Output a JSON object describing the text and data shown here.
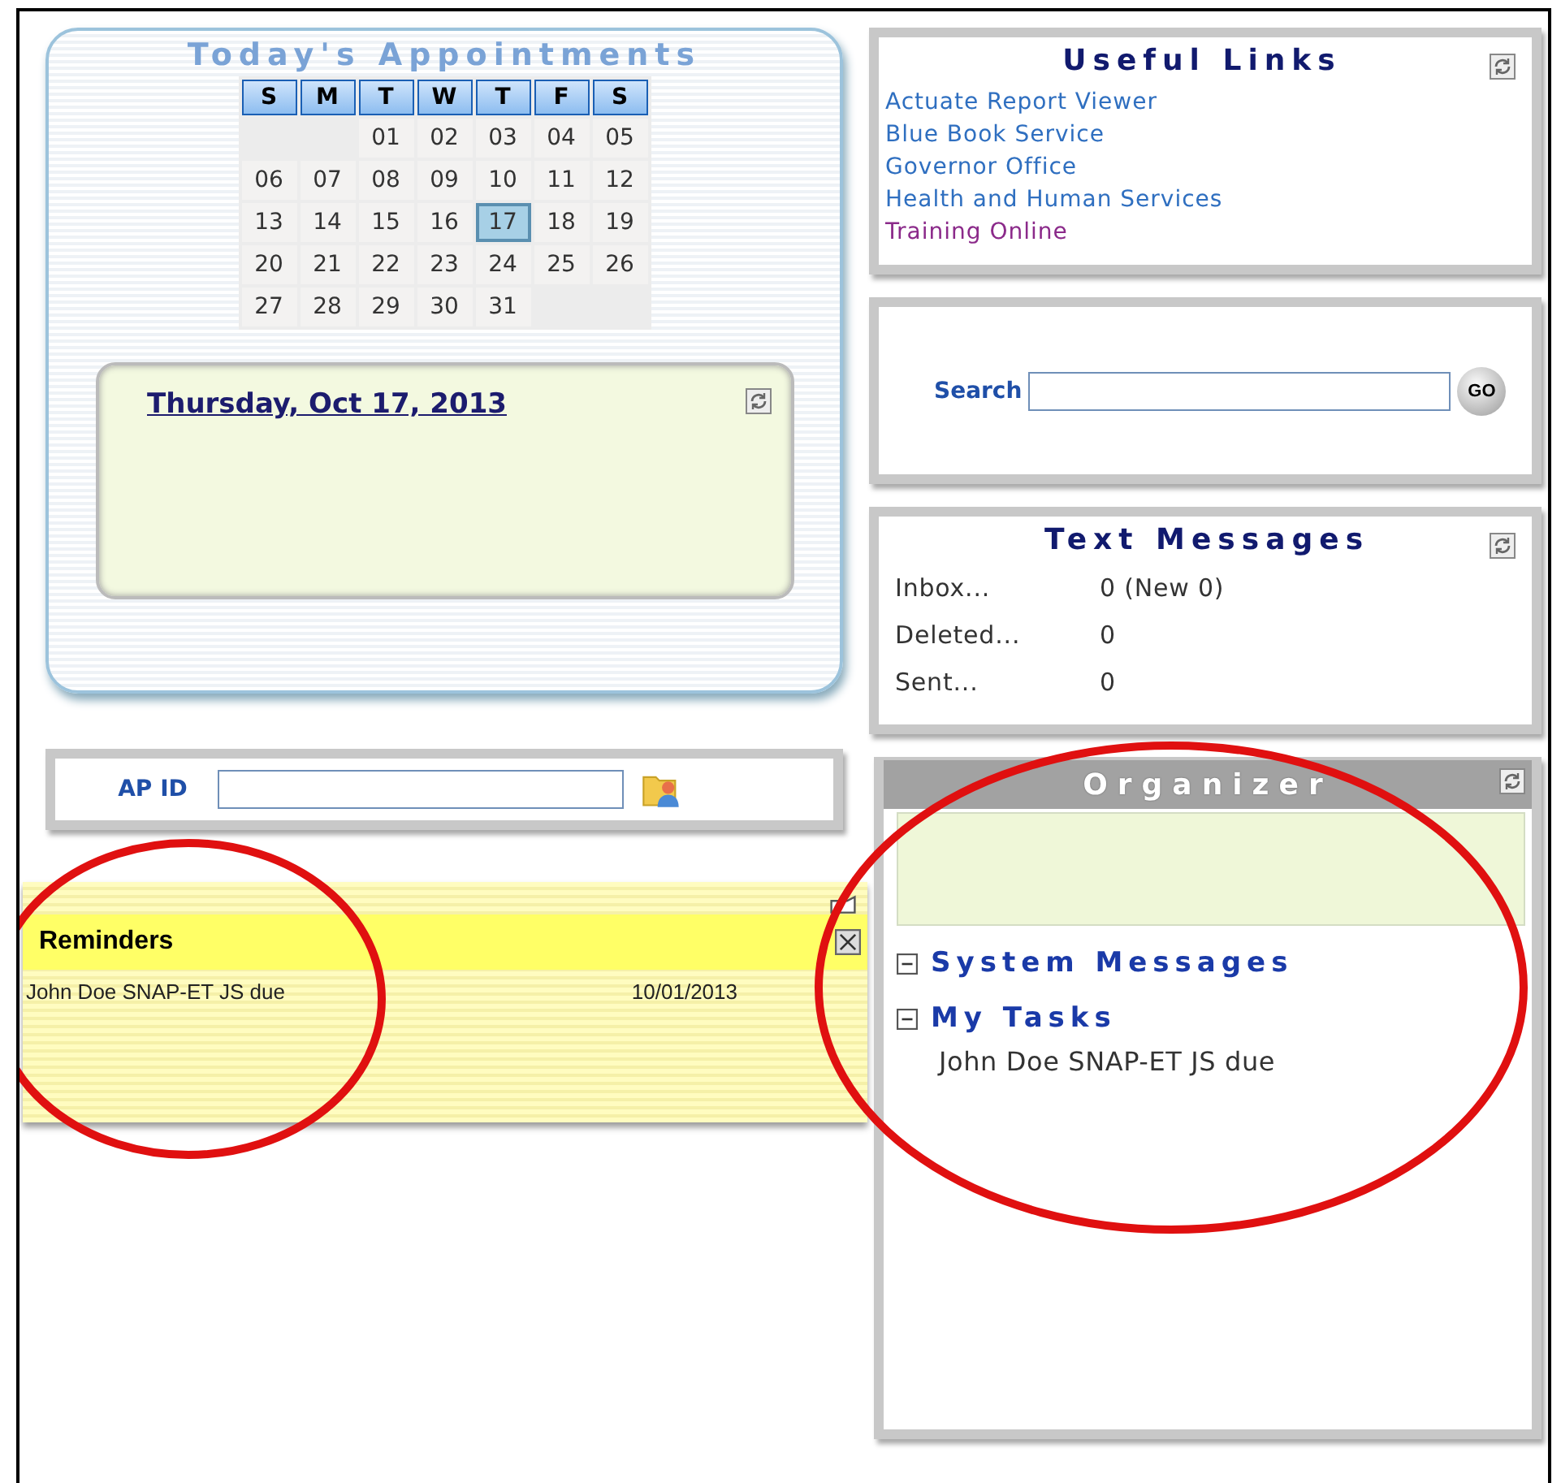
{
  "appointments": {
    "title": "Today's Appointments",
    "weekdays": [
      "S",
      "M",
      "T",
      "W",
      "T",
      "F",
      "S"
    ],
    "weeks": [
      {
        "days": [
          {
            "label": "01",
            "selected": false
          },
          {
            "label": "02",
            "selected": false
          },
          {
            "label": "03",
            "selected": false
          },
          {
            "label": "04",
            "selected": false
          },
          {
            "label": "05",
            "selected": false
          }
        ]
      },
      {
        "days": [
          {
            "label": "06",
            "selected": false
          },
          {
            "label": "07",
            "selected": false
          },
          {
            "label": "08",
            "selected": false
          },
          {
            "label": "09",
            "selected": false
          },
          {
            "label": "10",
            "selected": false
          },
          {
            "label": "11",
            "selected": false
          },
          {
            "label": "12",
            "selected": false
          }
        ]
      },
      {
        "days": [
          {
            "label": "13",
            "selected": false
          },
          {
            "label": "14",
            "selected": false
          },
          {
            "label": "15",
            "selected": false
          },
          {
            "label": "16",
            "selected": false
          },
          {
            "label": "17",
            "selected": true
          },
          {
            "label": "18",
            "selected": false
          },
          {
            "label": "19",
            "selected": false
          }
        ]
      },
      {
        "days": [
          {
            "label": "20",
            "selected": false
          },
          {
            "label": "21",
            "selected": false
          },
          {
            "label": "22",
            "selected": false
          },
          {
            "label": "23",
            "selected": false
          },
          {
            "label": "24",
            "selected": false
          },
          {
            "label": "25",
            "selected": false
          },
          {
            "label": "26",
            "selected": false
          }
        ]
      },
      {
        "days": [
          {
            "label": "27",
            "selected": false
          },
          {
            "label": "28",
            "selected": false
          },
          {
            "label": "29",
            "selected": false
          },
          {
            "label": "30",
            "selected": false
          },
          {
            "label": "31",
            "selected": false
          }
        ]
      }
    ],
    "date_heading": "Thursday, Oct 17, 2013"
  },
  "ap_id": {
    "label": "AP ID"
  },
  "reminders": {
    "title": "Reminders",
    "rows": [
      {
        "text": "John Doe SNAP-ET JS due",
        "date": "10/01/2013"
      }
    ]
  },
  "useful_links": {
    "title": "Useful Links",
    "links": [
      {
        "label": "Actuate Report Viewer",
        "visited": false
      },
      {
        "label": "Blue Book Service",
        "visited": false
      },
      {
        "label": "Governor Office",
        "visited": false
      },
      {
        "label": "Health and Human Services",
        "visited": false
      },
      {
        "label": "Training Online",
        "visited": true
      }
    ]
  },
  "search": {
    "label": "Search",
    "button": "GO"
  },
  "text_messages": {
    "title": "Text Messages",
    "rows": [
      {
        "label": "Inbox...",
        "value": "0 (New 0)"
      },
      {
        "label": "Deleted...",
        "value": "0"
      },
      {
        "label": "Sent...",
        "value": "0"
      }
    ]
  },
  "organizer": {
    "title": "Organizer",
    "sections": [
      {
        "title": "System Messages",
        "expanded": true
      },
      {
        "title": "My Tasks",
        "expanded": true,
        "children": [
          {
            "text": "John Doe SNAP-ET JS due"
          }
        ]
      }
    ]
  }
}
